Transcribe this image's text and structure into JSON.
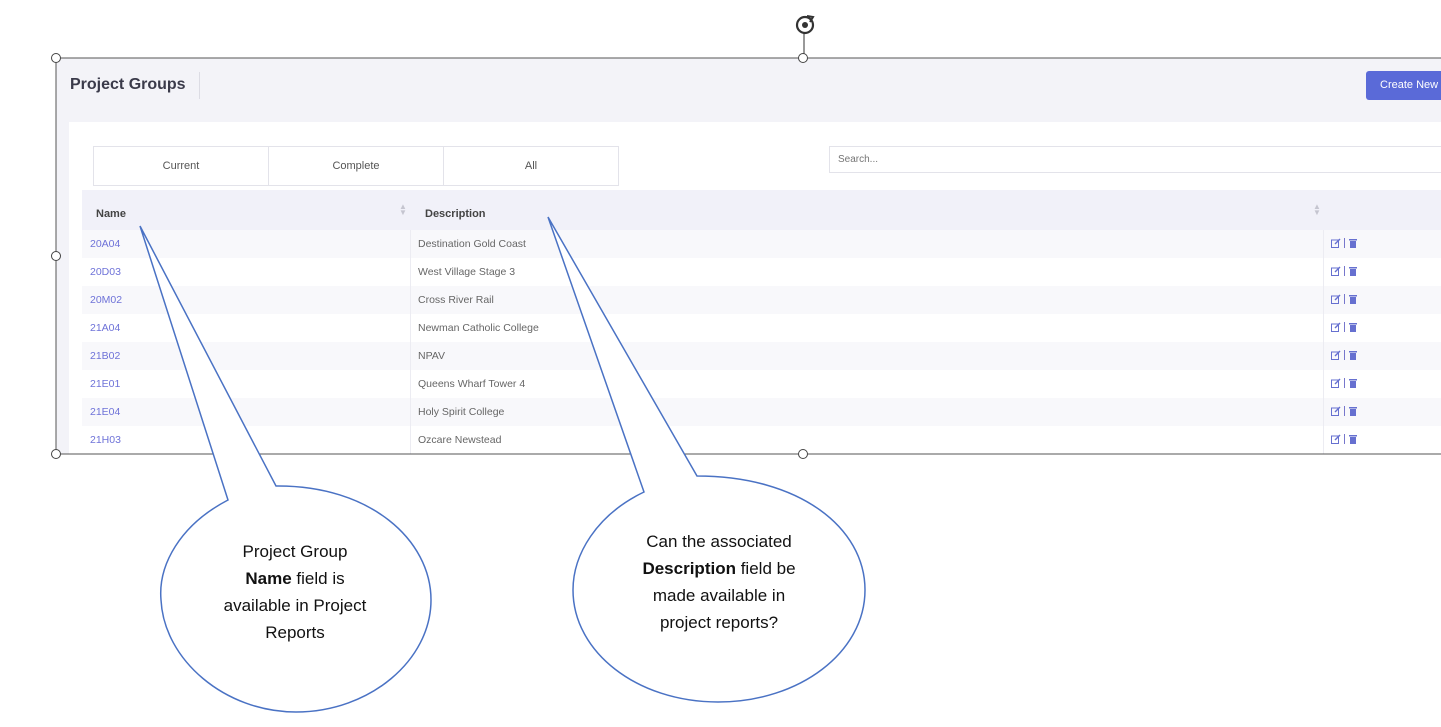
{
  "header": {
    "title": "Project Groups",
    "create_button": "Create New"
  },
  "tabs": [
    "Current",
    "Complete",
    "All"
  ],
  "search": {
    "placeholder": "Search..."
  },
  "table": {
    "columns": [
      "Name",
      "Description"
    ],
    "rows": [
      {
        "name": "20A04",
        "description": "Destination Gold Coast"
      },
      {
        "name": "20D03",
        "description": "West Village Stage 3"
      },
      {
        "name": "20M02",
        "description": "Cross River Rail"
      },
      {
        "name": "21A04",
        "description": "Newman Catholic College"
      },
      {
        "name": "21B02",
        "description": "NPAV"
      },
      {
        "name": "21E01",
        "description": "Queens Wharf Tower 4"
      },
      {
        "name": "21E04",
        "description": "Holy Spirit College"
      },
      {
        "name": "21H03",
        "description": "Ozcare Newstead"
      }
    ]
  },
  "callouts": {
    "left": {
      "line1": "Project Group",
      "line2_bold": "Name",
      "line2_rest": " field is",
      "line3": "available in Project",
      "line4": "Reports"
    },
    "right": {
      "line1": "Can the associated",
      "line2_bold": "Description",
      "line2_rest": " field be",
      "line3": "made available in",
      "line4": "project reports?"
    }
  },
  "colors": {
    "accent": "#5a6ad8",
    "link": "#6e72d8",
    "callout_stroke": "#4a72c4"
  },
  "icons": [
    "rotate-handle-icon",
    "edit-icon",
    "trash-icon",
    "sort-icon"
  ]
}
